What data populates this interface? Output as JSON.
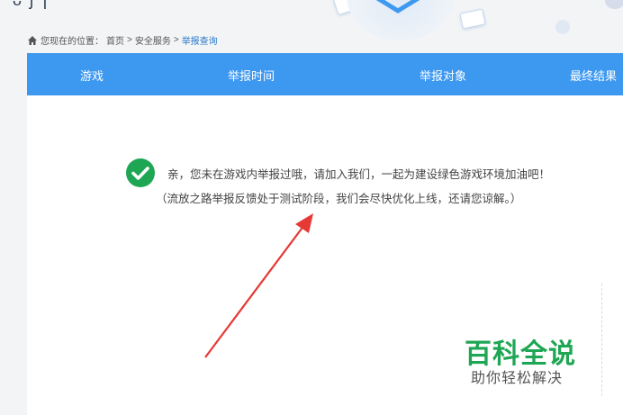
{
  "header": {
    "logo_fragment": "ᴗ ʃ ɿ"
  },
  "breadcrumb": {
    "prefix": "您现在的位置：",
    "items": [
      "首页",
      "安全服务",
      "举报查询"
    ],
    "separator": ">"
  },
  "table": {
    "columns": [
      "游戏",
      "举报时间",
      "举报对象",
      "最终结果"
    ]
  },
  "message": {
    "main": "亲，您未在游戏内举报过哦，请加入我们，一起为建设绿色游戏环境加油吧！",
    "sub": "（流放之路举报反馈处于测试阶段，我们会尽快优化上线，还请您谅解。）"
  },
  "watermark": {
    "title": "百科全说",
    "subtitle": "助你轻松解决"
  },
  "colors": {
    "header_bg": "#3d98f0",
    "check": "#1fa654",
    "arrow": "#e53935",
    "link": "#2b79c8"
  }
}
